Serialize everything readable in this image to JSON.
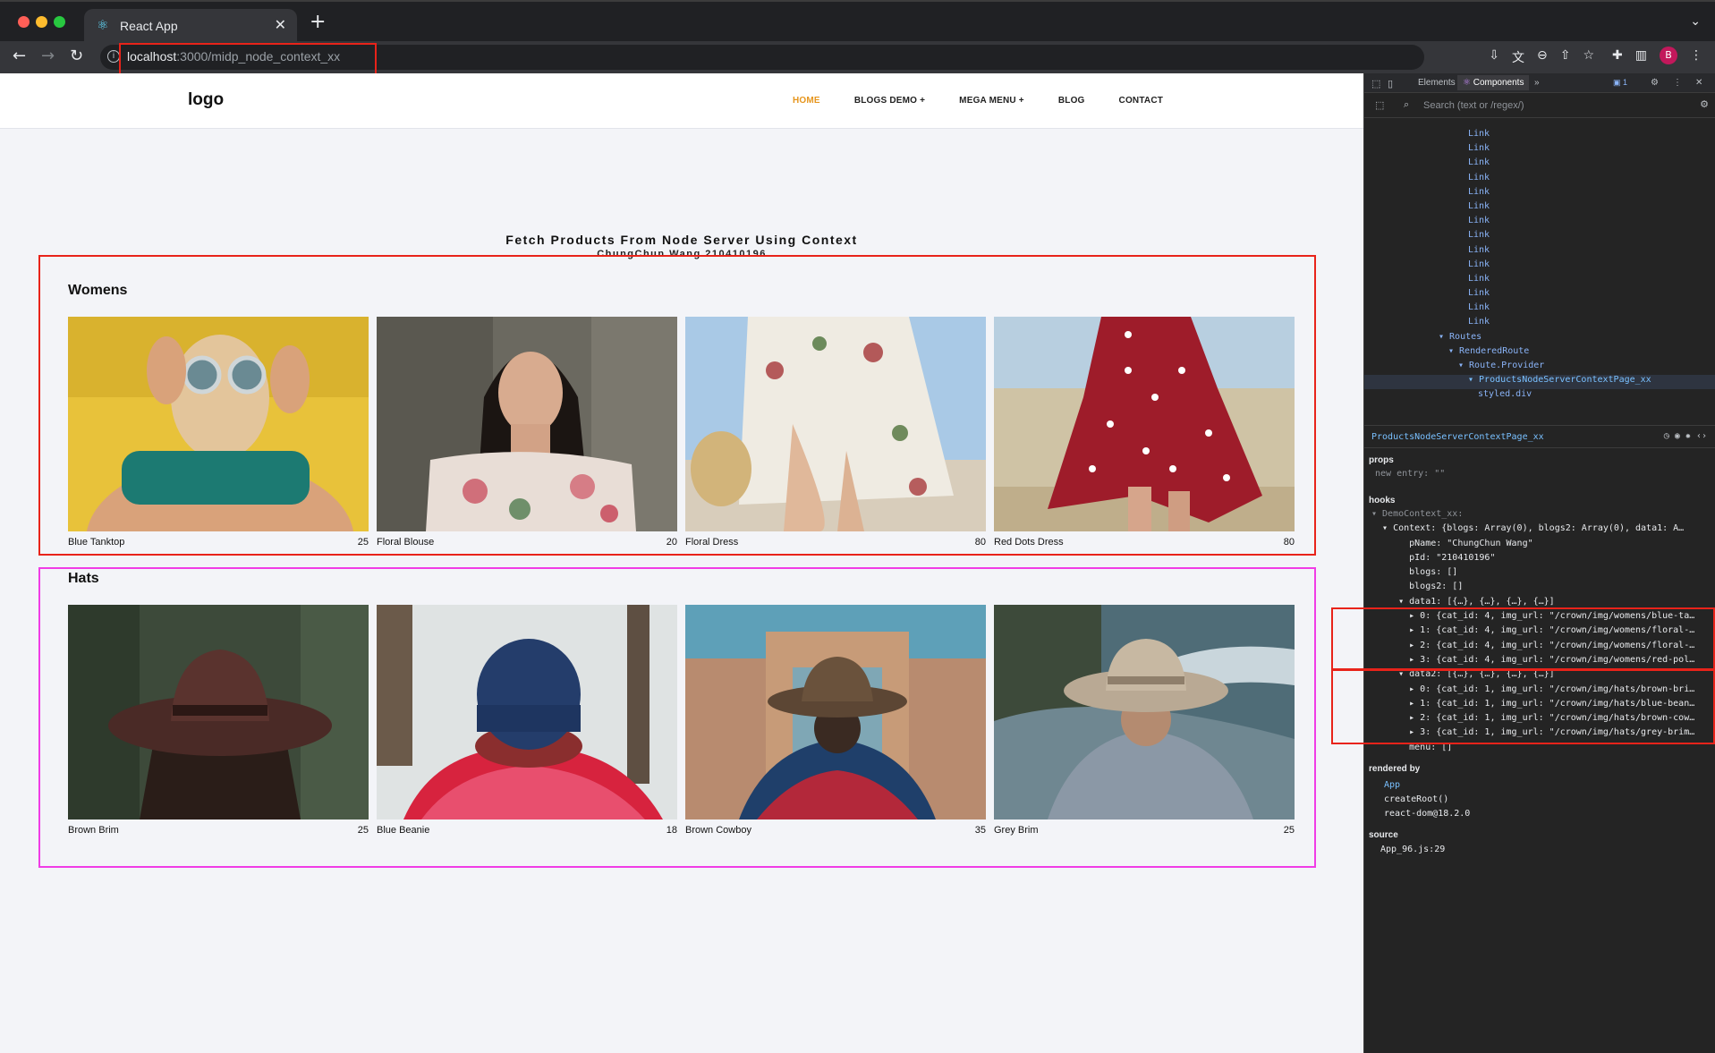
{
  "browser": {
    "tab_title": "React App",
    "url_host": "localhost",
    "url_path": ":3000/midp_node_context_xx",
    "icons": [
      "back-icon",
      "forward-icon",
      "reload-icon",
      "info-icon",
      "install-icon",
      "translate-icon",
      "zoom-icon",
      "share-icon",
      "bookmark-star-icon",
      "extensions-icon",
      "side-panel-icon",
      "profile-avatar",
      "more-icon"
    ],
    "avatar_letter": "B"
  },
  "site": {
    "logo": "logo",
    "nav": [
      "HOME",
      "BLOGS DEMO +",
      "MEGA MENU +",
      "BLOG",
      "CONTACT"
    ],
    "accent_color": "#e6961e",
    "title": "Fetch Products From Node Server Using Context",
    "subtitle": "ChungChun Wang 210410196"
  },
  "sections": [
    {
      "title": "Womens",
      "items": [
        {
          "name": "Blue Tanktop",
          "price": "25"
        },
        {
          "name": "Floral Blouse",
          "price": "20"
        },
        {
          "name": "Floral Dress",
          "price": "80"
        },
        {
          "name": "Red Dots Dress",
          "price": "80"
        }
      ]
    },
    {
      "title": "Hats",
      "items": [
        {
          "name": "Brown Brim",
          "price": "25"
        },
        {
          "name": "Blue Beanie",
          "price": "18"
        },
        {
          "name": "Brown Cowboy",
          "price": "35"
        },
        {
          "name": "Grey Brim",
          "price": "25"
        }
      ]
    }
  ],
  "devtools": {
    "tabs": [
      "Elements",
      "Components"
    ],
    "badge": "1",
    "search_placeholder": "Search (text or /regex/)",
    "tree": [
      {
        "indent": 0,
        "text": "Link"
      },
      {
        "indent": 0,
        "text": "Link"
      },
      {
        "indent": 0,
        "text": "Link"
      },
      {
        "indent": 0,
        "text": "Link"
      },
      {
        "indent": 0,
        "text": "Link"
      },
      {
        "indent": 0,
        "text": "Link"
      },
      {
        "indent": 0,
        "text": "Link"
      },
      {
        "indent": 0,
        "text": "Link"
      },
      {
        "indent": 0,
        "text": "Link"
      },
      {
        "indent": 0,
        "text": "Link"
      },
      {
        "indent": 0,
        "text": "Link"
      },
      {
        "indent": 0,
        "text": "Link"
      },
      {
        "indent": 0,
        "text": "Link"
      },
      {
        "indent": 0,
        "text": "Link"
      },
      {
        "indent": -3,
        "text": "▾ Routes"
      },
      {
        "indent": -2,
        "text": "▾ RenderedRoute"
      },
      {
        "indent": -1,
        "text": "▾ Route.Provider"
      },
      {
        "indent": 0,
        "text": "▾ ProductsNodeServerContextPage_xx",
        "selected": true
      },
      {
        "indent": 1,
        "text": "styled.div"
      }
    ],
    "selected_component": "ProductsNodeServerContextPage_xx",
    "props_label": "props",
    "props_line": "new entry: \"\"",
    "hooks_label": "hooks",
    "hooks": [
      "▾ DemoContext_xx:",
      "  ▾ Context: {blogs: Array(0), blogs2: Array(0), data1: A…",
      "       pName: \"ChungChun Wang\"",
      "       pId: \"210410196\"",
      "       blogs: []",
      "       blogs2: []",
      "     ▾ data1: [{…}, {…}, {…}, {…}]",
      "       ▸ 0: {cat_id: 4, img_url: \"/crown/img/womens/blue-ta…",
      "       ▸ 1: {cat_id: 4, img_url: \"/crown/img/womens/floral-…",
      "       ▸ 2: {cat_id: 4, img_url: \"/crown/img/womens/floral-…",
      "       ▸ 3: {cat_id: 4, img_url: \"/crown/img/womens/red-pol…",
      "     ▾ data2: [{…}, {…}, {…}, {…}]",
      "       ▸ 0: {cat_id: 1, img_url: \"/crown/img/hats/brown-bri…",
      "       ▸ 1: {cat_id: 1, img_url: \"/crown/img/hats/blue-bean…",
      "       ▸ 2: {cat_id: 1, img_url: \"/crown/img/hats/brown-cow…",
      "       ▸ 3: {cat_id: 1, img_url: \"/crown/img/hats/grey-brim…",
      "       menu: []"
    ],
    "rendered_by_label": "rendered by",
    "rendered_by": [
      "App",
      "createRoot()",
      "react-dom@18.2.0"
    ],
    "source_label": "source",
    "source": "App_96.js:29"
  }
}
